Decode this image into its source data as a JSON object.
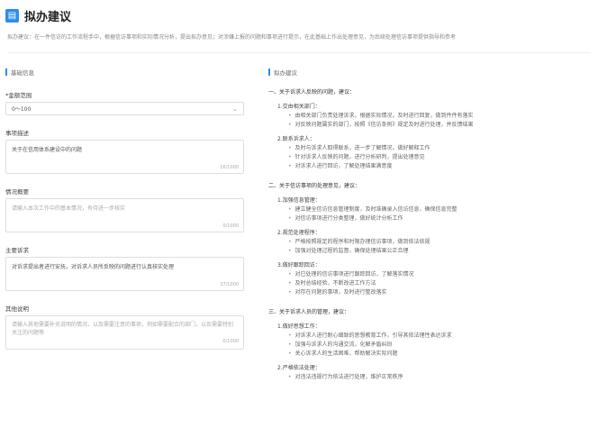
{
  "header": {
    "logo_icon": "document-icon",
    "title": "拟办建议"
  },
  "description": "拟办建议：在一件信访的工作流程手中，根据信访事项和实际情况分析，提出拟办意见；对涉嫌上报的问题和事项进行提示，在此基础上作出处理意见，为后续处理信访事项提供指导和参考",
  "form": {
    "section_title": "基础信息",
    "amount_label": "*金额范围",
    "amount_value": "0～100",
    "subject_label": "事项描述",
    "subject_value": "关于在信用体系建设中的问题",
    "subject_count": "16/1000",
    "notes_label": "情况概要",
    "notes_placeholder": "请输入本次工作中的基本情况，有待进一步核实",
    "notes_count": "0/1000",
    "appeal_label": "主要诉求",
    "appeal_value": "对诉求提出者进行安抚，对诉求人员所反映的问题进行认真核实处理",
    "appeal_count": "37/1000",
    "other_label": "其他说明",
    "other_placeholder": "请输入其他需要补充说明的情况，以及需要注意的事项，例如需要配合的部门，以及需要特别关注的问题等",
    "other_count": "0/1000"
  },
  "suggestion": {
    "section_title": "拟办建议",
    "lines": [
      {
        "level": "h1",
        "text": "一、关于诉求人反映的问题，建议："
      },
      {
        "level": "h2",
        "text": "1.交由相关部门："
      },
      {
        "level": "b",
        "text": "由相关部门负责处理诉求，根据实际情况，及时进行回复，做到件件有落实"
      },
      {
        "level": "b",
        "text": "对反映问题属实的部门，按照《信访条例》规定及时进行处理，并反馈结果"
      },
      {
        "level": "h2",
        "text": "2.联系诉求人："
      },
      {
        "level": "b",
        "text": "及时与诉求人取得联系，进一步了解情况，做好解释工作"
      },
      {
        "level": "b",
        "text": "针对诉求人反映的问题，进行分析研判，提出处理意见"
      },
      {
        "level": "b",
        "text": "对诉求人进行回访，了解处理结果满意度"
      },
      {
        "level": "h1",
        "text": "二、关于信访事项的处理意见，建议："
      },
      {
        "level": "h2",
        "text": "1.加强信息管理："
      },
      {
        "level": "b",
        "text": "建立健全信访信息管理制度，及时准确录入信访信息，确保信息完整"
      },
      {
        "level": "b",
        "text": "对信访事项进行分类整理，做好统计分析工作"
      },
      {
        "level": "h2",
        "text": "2.规范处理程序："
      },
      {
        "level": "b",
        "text": "严格按照规定的程序和时限办理信访事项，做到依法依规"
      },
      {
        "level": "b",
        "text": "加强对处理过程的监督，确保处理结果公正合理"
      },
      {
        "level": "h2",
        "text": "3.做好跟踪回访："
      },
      {
        "level": "b",
        "text": "对已处理的信访事项进行跟踪回访，了解落实情况"
      },
      {
        "level": "b",
        "text": "及时总结经验，不断改进工作方法"
      },
      {
        "level": "b",
        "text": "对存在问题的事项，及时进行整改落实"
      },
      {
        "level": "h1",
        "text": "三、关于诉求人员的管理，建议："
      },
      {
        "level": "h2",
        "text": "1.做好思想工作："
      },
      {
        "level": "b",
        "text": "对诉求人进行耐心细致的思想教育工作，引导其依法理性表达诉求"
      },
      {
        "level": "b",
        "text": "加强与诉求人的沟通交流，化解矛盾纠纷"
      },
      {
        "level": "b",
        "text": "关心诉求人的生活困难，帮助解决实际问题"
      },
      {
        "level": "h2",
        "text": "2.严格依法处理："
      },
      {
        "level": "b",
        "text": "对违法违规行为依法进行处理，维护正常秩序"
      }
    ]
  }
}
